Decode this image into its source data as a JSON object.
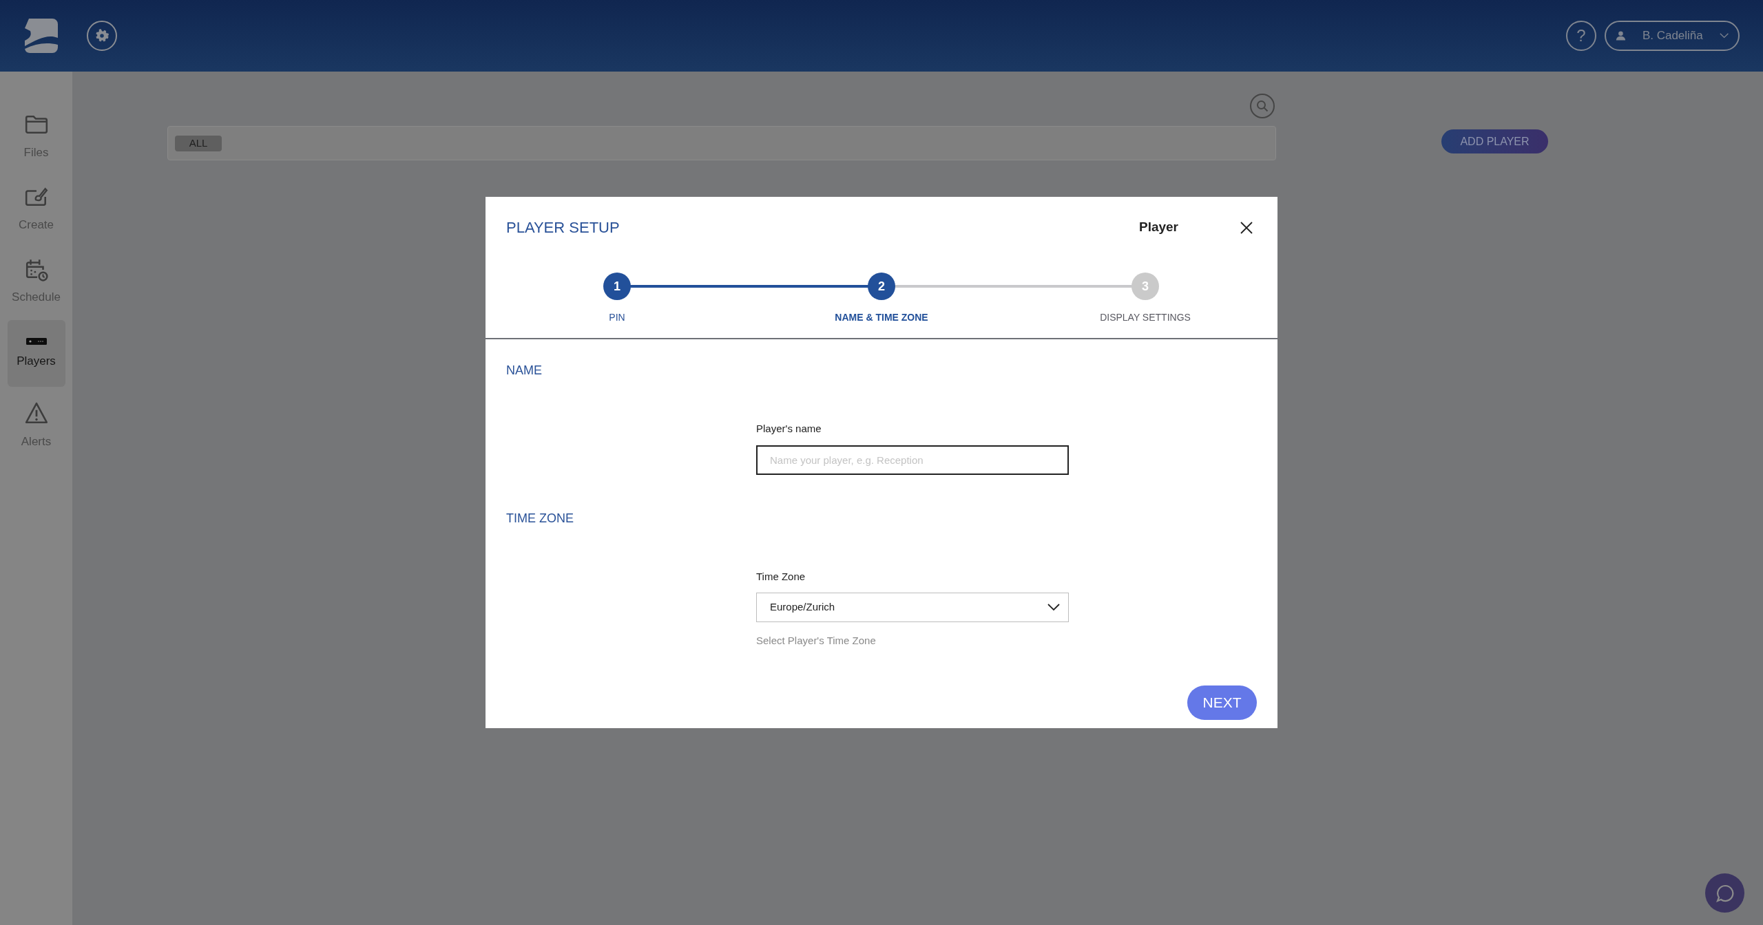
{
  "header": {
    "help_button": "?",
    "user_menu": {
      "name": "B. Cadeliña"
    }
  },
  "sidebar": {
    "items": [
      {
        "label": "Files",
        "kind": "folder",
        "selected": false
      },
      {
        "label": "Create",
        "kind": "create",
        "selected": false
      },
      {
        "label": "Schedule",
        "kind": "schedule",
        "selected": false
      },
      {
        "label": "Players",
        "kind": "player",
        "selected": true
      },
      {
        "label": "Alerts",
        "kind": "alert",
        "selected": false
      }
    ]
  },
  "toolbar": {
    "filters": [
      {
        "label": "ALL",
        "selected": true
      }
    ],
    "add_button": "ADD PLAYER"
  },
  "modal": {
    "title": "PLAYER SETUP",
    "subtitle": "Player",
    "steps": [
      {
        "number": "1",
        "label": "PIN",
        "selected": false
      },
      {
        "number": "2",
        "label": "NAME & TIME ZONE",
        "selected": true
      },
      {
        "number": "3",
        "label": "DISPLAY SETTINGS",
        "selected": false
      }
    ],
    "sections": [
      {
        "heading": "NAME",
        "field": {
          "kind": "text",
          "label": "Player's name",
          "placeholder": "Name your player, e.g. Reception"
        }
      },
      {
        "heading": "TIME ZONE",
        "field": {
          "kind": "select",
          "label": "Time Zone",
          "value": "Europe/Zurich",
          "hint": "Select Player's Time Zone"
        }
      }
    ],
    "next_button": "NEXT"
  }
}
